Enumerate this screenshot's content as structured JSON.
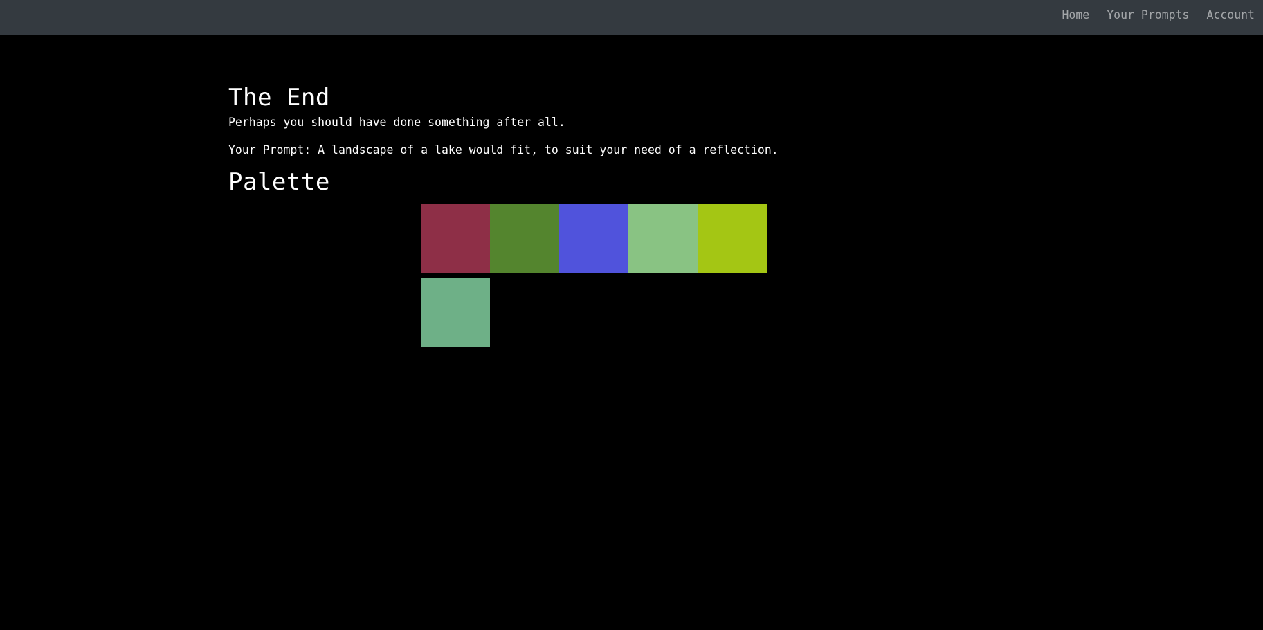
{
  "nav": {
    "links": [
      "Home",
      "Your Prompts",
      "Account"
    ]
  },
  "main": {
    "title": "The End",
    "subtitle": "Perhaps you should have done something after all.",
    "prompt": "Your Prompt: A landscape of a lake would fit, to suit your need of a reflection.",
    "palette_heading": "Palette"
  },
  "palette": {
    "colors": [
      "#8e2f47",
      "#54852e",
      "#5053dc",
      "#89c383",
      "#a4c614",
      "#6eb087"
    ]
  },
  "theme": {
    "background": "#000000",
    "navbar": "#343a40",
    "text": "#ffffff",
    "nav_link": "#9a9da0"
  }
}
